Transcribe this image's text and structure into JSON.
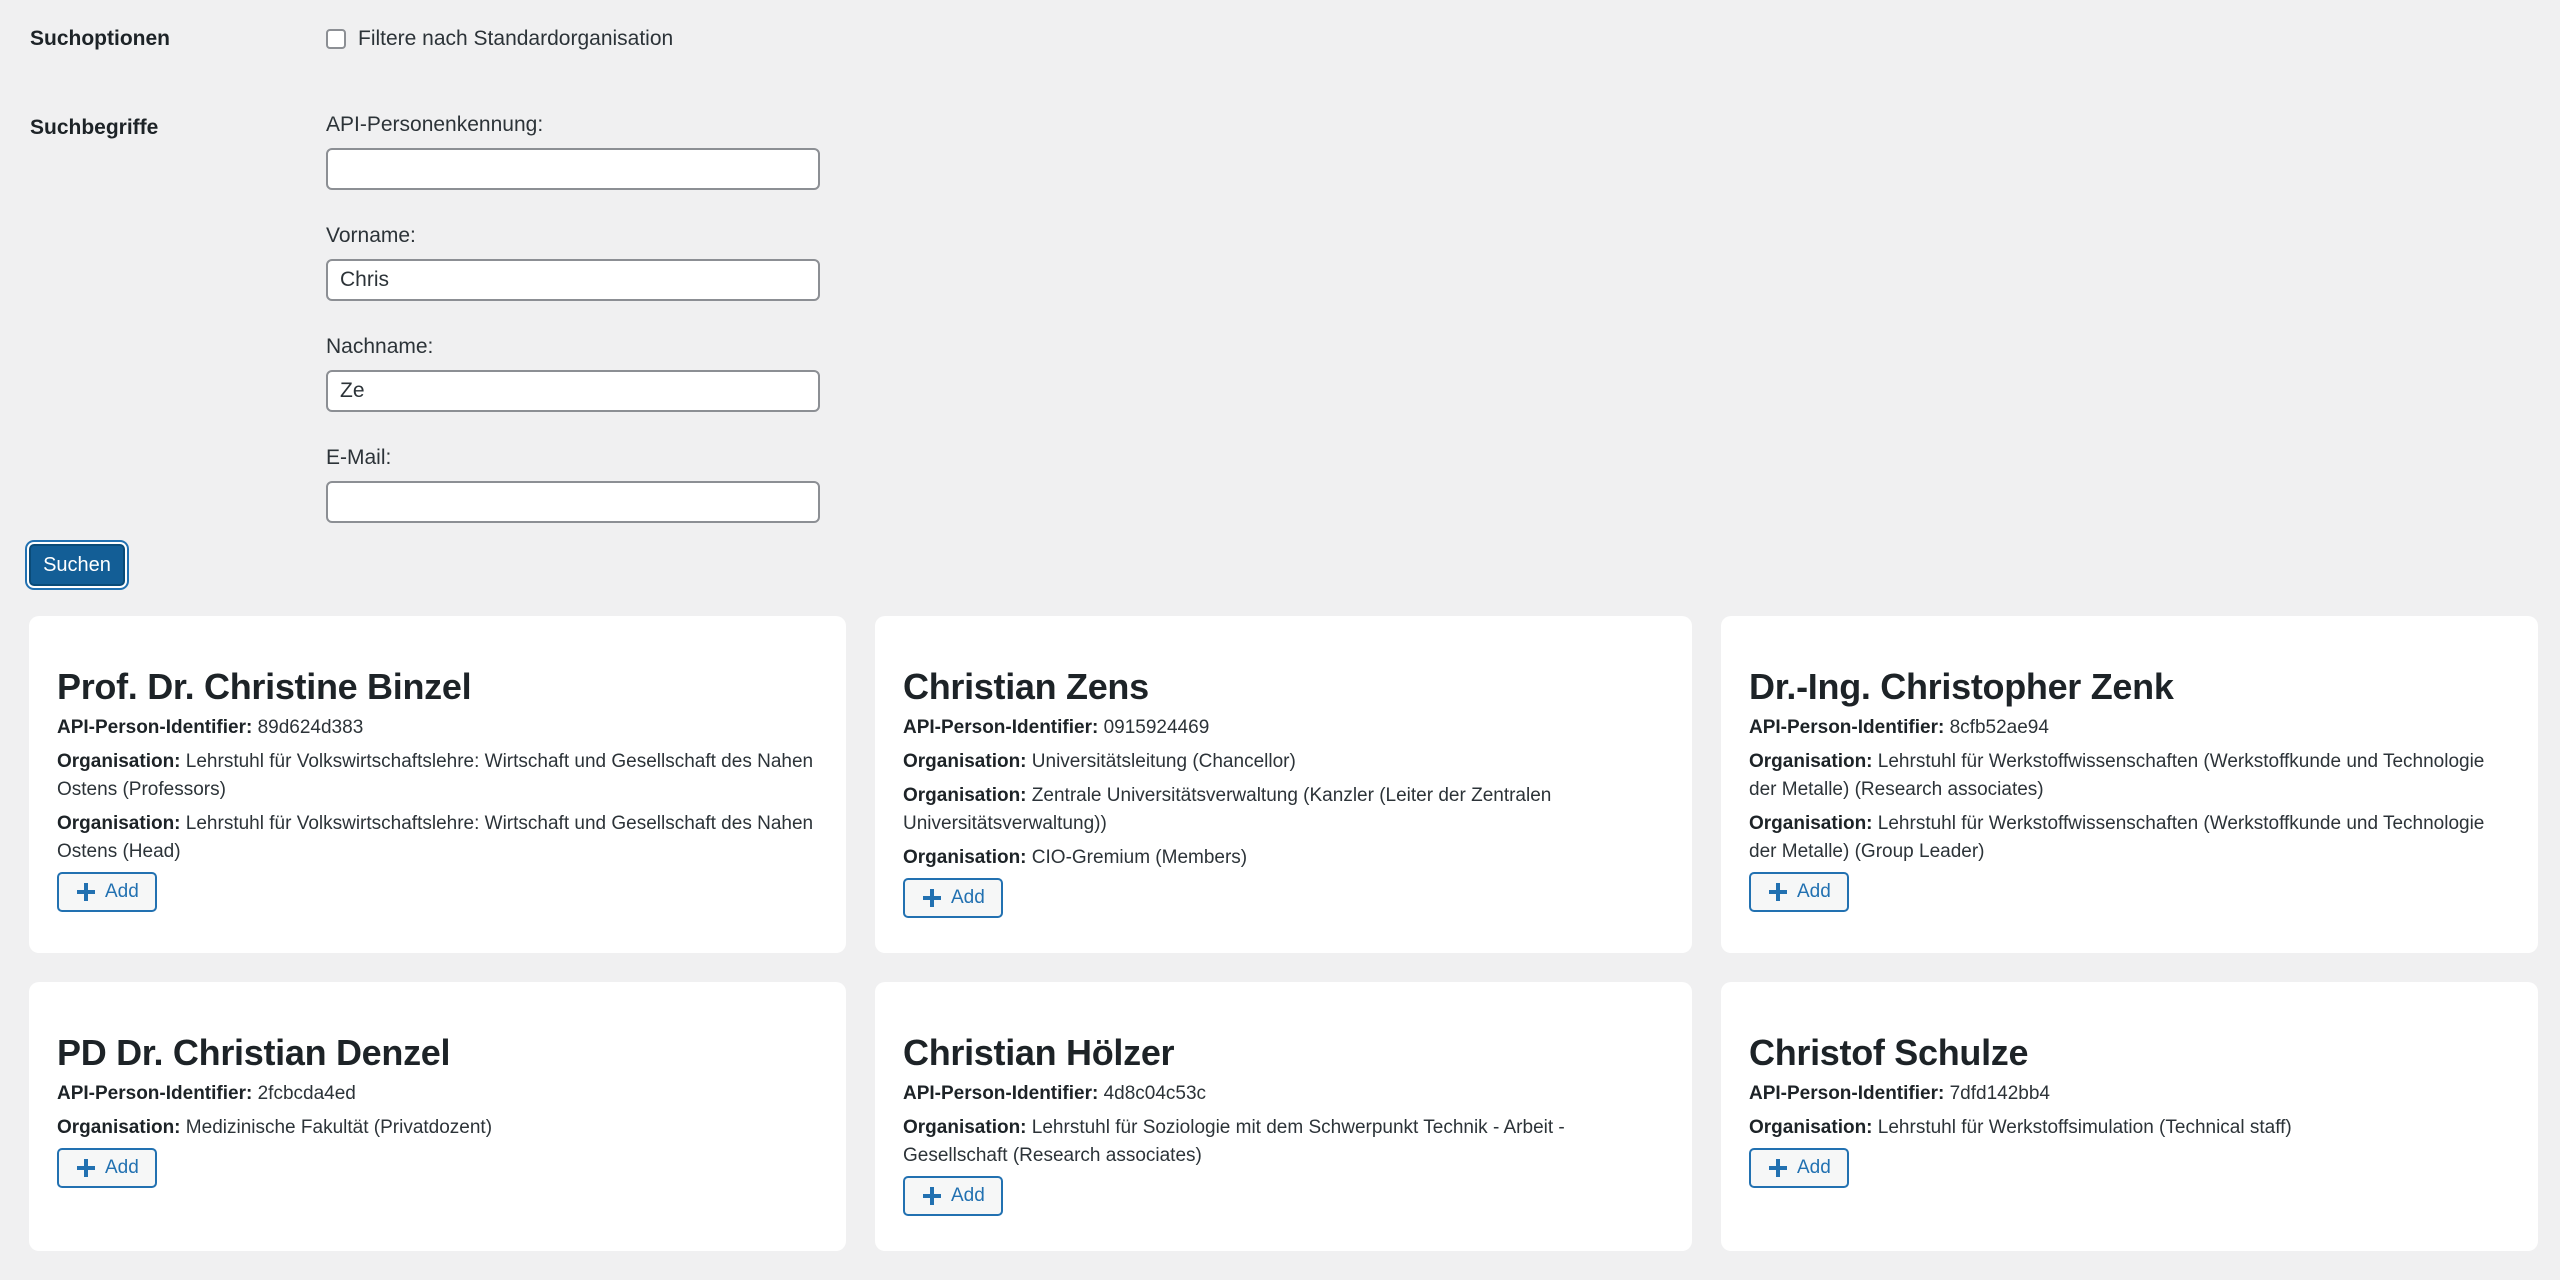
{
  "search_options": {
    "label": "Suchoptionen",
    "filter_label": "Filtere nach Standardorganisation"
  },
  "search_terms": {
    "label": "Suchbegriffe",
    "fields": [
      {
        "label": "API-Personenkennung:",
        "value": ""
      },
      {
        "label": "Vorname:",
        "value": "Chris"
      },
      {
        "label": "Nachname:",
        "value": "Ze"
      },
      {
        "label": "E-Mail:",
        "value": ""
      }
    ],
    "submit_label": "Suchen"
  },
  "labels": {
    "identifier": "API-Person-Identifier:",
    "organisation": "Organisation:",
    "add": "Add"
  },
  "results": [
    {
      "name": "Prof. Dr. Christine Binzel",
      "identifier": "89d624d383",
      "organisations": [
        "Lehrstuhl für Volkswirtschaftslehre: Wirtschaft und Gesellschaft des Nahen Ostens (Professors)",
        "Lehrstuhl für Volkswirtschaftslehre: Wirtschaft und Gesellschaft des Nahen Ostens (Head)"
      ]
    },
    {
      "name": "Christian Zens",
      "identifier": "0915924469",
      "organisations": [
        "Universitätsleitung (Chancellor)",
        "Zentrale Universitätsverwaltung (Kanzler (Leiter der Zentralen Universitätsverwaltung))",
        "CIO-Gremium (Members)"
      ]
    },
    {
      "name": "Dr.-Ing. Christopher Zenk",
      "identifier": "8cfb52ae94",
      "organisations": [
        "Lehrstuhl für Werkstoffwissenschaften (Werkstoffkunde und Technologie der Metalle) (Research associates)",
        "Lehrstuhl für Werkstoffwissenschaften (Werkstoffkunde und Technologie der Metalle) (Group Leader)"
      ]
    },
    {
      "name": "PD Dr. Christian Denzel",
      "identifier": "2fcbcda4ed",
      "organisations": [
        "Medizinische Fakultät (Privatdozent)"
      ]
    },
    {
      "name": "Christian Hölzer",
      "identifier": "4d8c04c53c",
      "organisations": [
        "Lehrstuhl für Soziologie mit dem Schwerpunkt Technik - Arbeit - Gesellschaft (Research associates)"
      ]
    },
    {
      "name": "Christof Schulze",
      "identifier": "7dfd142bb4",
      "organisations": [
        "Lehrstuhl für Werkstoffsimulation (Technical staff)"
      ]
    }
  ]
}
